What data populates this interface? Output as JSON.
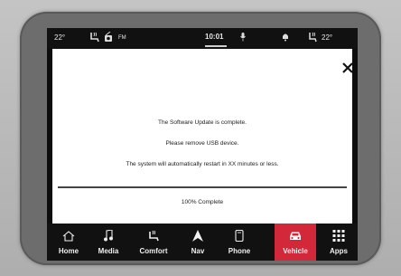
{
  "status": {
    "temp_left": "22°",
    "fm": "FM",
    "time": "10:01",
    "temp_right": "22°"
  },
  "dialog": {
    "line1": "The Software Update is complete.",
    "line2": "Please remove USB device.",
    "line3": "The system will automatically restart in XX minutes or less.",
    "progress": "100% Complete",
    "progress_value": 1.0
  },
  "nav": [
    {
      "label": "Home",
      "icon": "home-icon"
    },
    {
      "label": "Media",
      "icon": "music-note-icon"
    },
    {
      "label": "Comfort",
      "icon": "heated-seat-icon"
    },
    {
      "label": "Nav",
      "icon": "navigation-arrow-icon"
    },
    {
      "label": "Phone",
      "icon": "phone-icon"
    },
    {
      "label": "Vehicle",
      "icon": "car-icon",
      "active": true
    },
    {
      "label": "Apps",
      "icon": "grid-icon"
    }
  ],
  "colors": {
    "accent": "#d3283a",
    "bar": "#111111",
    "panel": "#ffffff"
  }
}
